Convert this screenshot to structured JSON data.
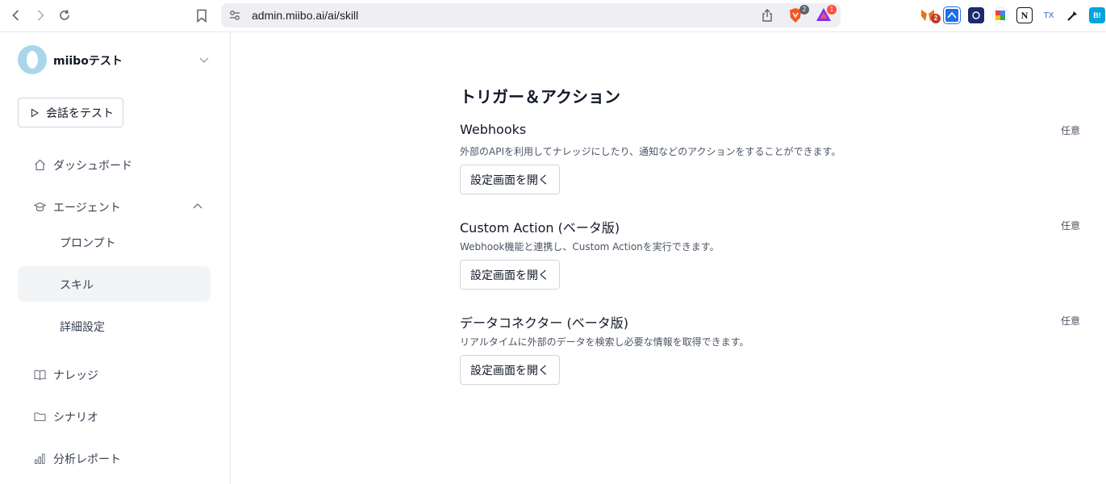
{
  "browser": {
    "url": "admin.miibo.ai/ai/skill",
    "ext_badge_1": "2",
    "ext_badge_2": "1",
    "ext_badge_3": "2",
    "ext_label_tx": "TX",
    "ext_label_bi": "B!",
    "ext_label_n": "N"
  },
  "sidebar": {
    "workspace_name": "miiboテスト",
    "test_button": "会話をテスト",
    "items": [
      {
        "label": "ダッシュボード",
        "icon": "home-icon"
      },
      {
        "label": "エージェント",
        "icon": "graduation-cap-icon"
      },
      {
        "label": "プロンプト"
      },
      {
        "label": "スキル"
      },
      {
        "label": "詳細設定"
      },
      {
        "label": "ナレッジ",
        "icon": "book-icon"
      },
      {
        "label": "シナリオ",
        "icon": "folder-icon"
      },
      {
        "label": "分析レポート",
        "icon": "bar-chart-icon"
      }
    ]
  },
  "main": {
    "heading": "トリガー＆アクション",
    "sections": [
      {
        "title": "Webhooks",
        "optional": "任意",
        "description": "外部のAPIを利用してナレッジにしたり、通知などのアクションをすることができます。",
        "button": "設定画面を開く"
      },
      {
        "title": "Custom Action (ベータ版)",
        "optional": "任意",
        "description": "Webhook機能と連携し、Custom Actionを実行できます。",
        "button": "設定画面を開く"
      },
      {
        "title": "データコネクター (ベータ版)",
        "optional": "任意",
        "description": "リアルタイムに外部のデータを検索し必要な情報を取得できます。",
        "button": "設定画面を開く"
      }
    ]
  },
  "colors": {
    "accent_logo": "#a9d6ea",
    "active_bg": "#f3f4f6",
    "border": "#d1d5db"
  }
}
